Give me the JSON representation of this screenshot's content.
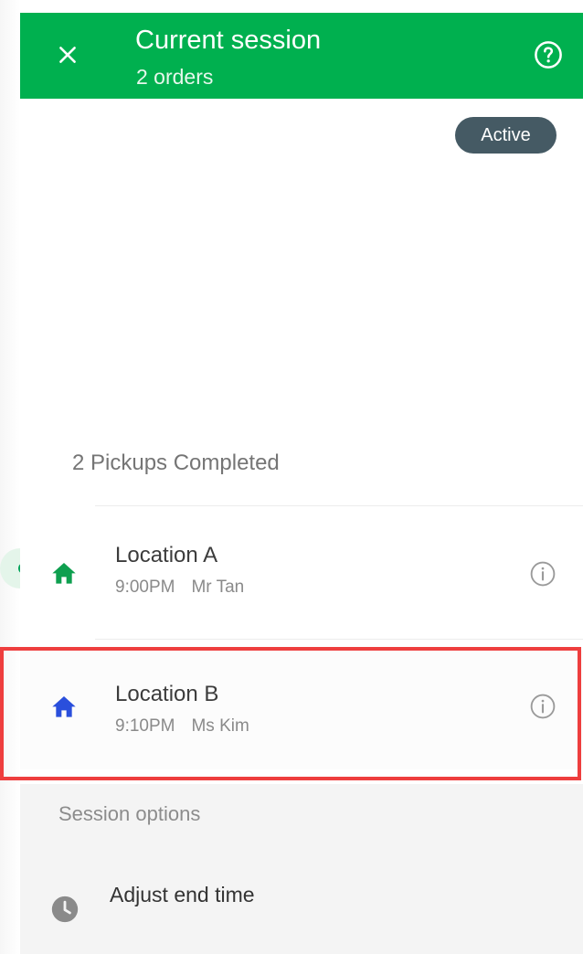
{
  "header": {
    "title": "Current session",
    "subtitle": "2 orders",
    "close_icon": "close-icon",
    "help_icon": "help-icon"
  },
  "status_badge": "Active",
  "pickups": {
    "header": "2 Pickups Completed",
    "items": [
      {
        "name": "Location A",
        "time": "9:00PM",
        "contact": "Mr Tan",
        "icon": "home-icon",
        "icon_color": "#0e9f4f"
      },
      {
        "name": "Location B",
        "time": "9:10PM",
        "contact": "Ms Kim",
        "icon": "home-icon",
        "icon_color": "#2a4fdc"
      }
    ]
  },
  "session_options": {
    "header": "Session options",
    "items": [
      {
        "label": "Adjust end time",
        "icon": "clock-icon"
      }
    ]
  },
  "colors": {
    "app_bar": "#00b04f",
    "badge": "#455a64",
    "highlight": "#ee3e3e"
  }
}
